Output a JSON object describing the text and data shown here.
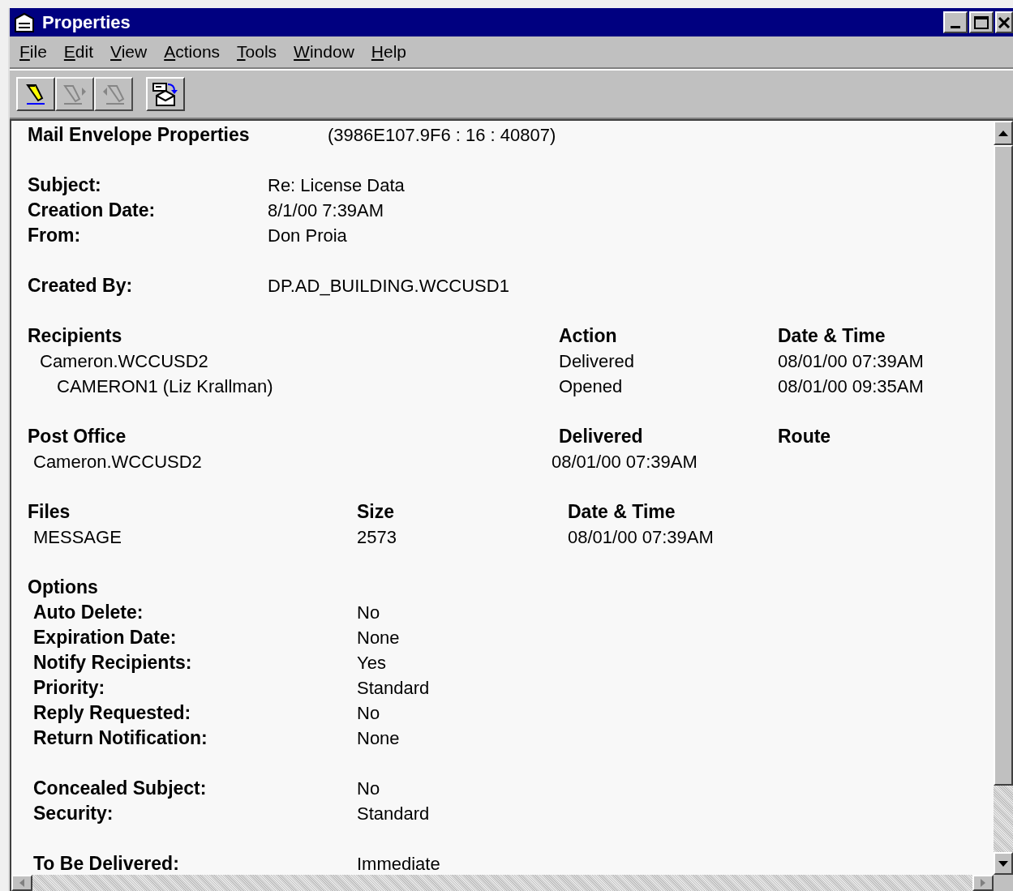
{
  "window": {
    "title": "Properties"
  },
  "menu": [
    {
      "label": "File"
    },
    {
      "label": "Edit"
    },
    {
      "label": "View"
    },
    {
      "label": "Actions"
    },
    {
      "label": "Tools"
    },
    {
      "label": "Window"
    },
    {
      "label": "Help"
    }
  ],
  "toolbar": [
    {
      "kind": "edit",
      "disabled": false
    },
    {
      "kind": "forward",
      "disabled": true
    },
    {
      "kind": "back",
      "disabled": true
    },
    {
      "kind": "open",
      "disabled": false
    }
  ],
  "header": {
    "title": "Mail Envelope Properties",
    "id": "(3986E107.9F6 : 16 : 40807)"
  },
  "fields": [
    {
      "label": "Subject:",
      "value": "Re: License Data"
    },
    {
      "label": "Creation Date:",
      "value": "8/1/00 7:39AM"
    },
    {
      "label": "From:",
      "value": "Don Proia"
    }
  ],
  "created_by": {
    "label": "Created By:",
    "value": "DP.AD_BUILDING.WCCUSD1"
  },
  "recipients": {
    "columns": [
      "Recipients",
      "Action",
      "Date & Time"
    ],
    "rows": [
      {
        "name": "Cameron.WCCUSD2",
        "action": "Delivered",
        "date": "08/01/00 07:39AM",
        "children": [
          {
            "name": "CAMERON1 (Liz Krallman)",
            "action": "Opened",
            "date": "08/01/00 09:35AM"
          }
        ]
      }
    ]
  },
  "post_office": {
    "columns": [
      "Post Office",
      "Delivered",
      "Route"
    ],
    "rows": [
      {
        "name": "Cameron.WCCUSD2",
        "delivered": "08/01/00 07:39AM"
      }
    ]
  },
  "files": {
    "columns": [
      "Files",
      "Size",
      "Date & Time"
    ],
    "rows": [
      {
        "name": "MESSAGE",
        "size": "2573",
        "date": "08/01/00 07:39AM"
      }
    ]
  },
  "options": {
    "heading": "Options",
    "groups": [
      [
        {
          "label": "Auto Delete:",
          "value": "No"
        },
        {
          "label": "Expiration Date:",
          "value": "None"
        },
        {
          "label": "Notify Recipients:",
          "value": "Yes"
        },
        {
          "label": "Priority:",
          "value": "Standard"
        },
        {
          "label": "Reply Requested:",
          "value": "No"
        },
        {
          "label": "Return Notification:",
          "value": "None"
        }
      ],
      [
        {
          "label": "Concealed Subject:",
          "value": "No"
        },
        {
          "label": "Security:",
          "value": "Standard"
        }
      ],
      [
        {
          "label": "To Be Delivered:",
          "value": "Immediate"
        }
      ]
    ]
  }
}
